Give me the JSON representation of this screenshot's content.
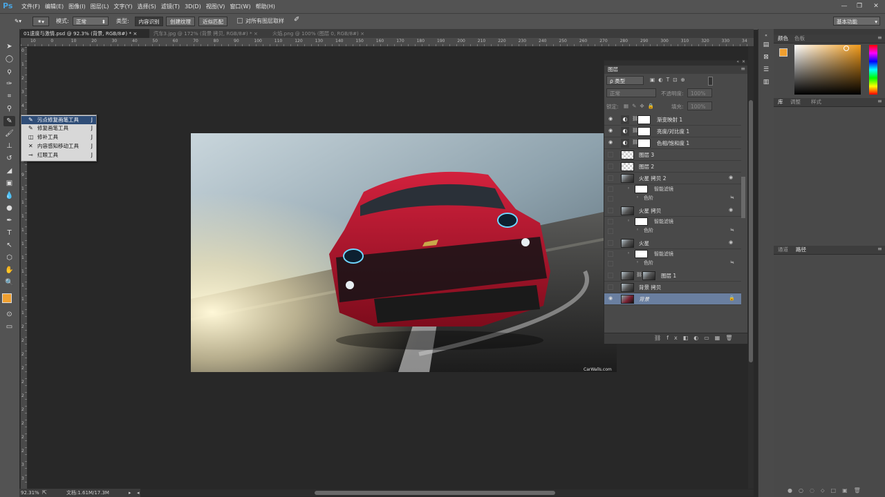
{
  "app": {
    "logo": "Ps",
    "brand_color": "#4aa3df"
  },
  "menu": [
    "文件(F)",
    "编辑(E)",
    "图像(I)",
    "图层(L)",
    "文字(Y)",
    "选择(S)",
    "滤镜(T)",
    "3D(D)",
    "视图(V)",
    "窗口(W)",
    "帮助(H)"
  ],
  "window_controls": {
    "minimize": "—",
    "restore": "❐",
    "close": "✕"
  },
  "options": {
    "mode_label": "模式:",
    "mode_value": "正常",
    "type_label": "类型:",
    "type_buttons": [
      "内容识别",
      "创建纹理",
      "近似匹配"
    ],
    "sample_all_layers": "对所有图层取样",
    "workspace": "基本功能"
  },
  "tabs": [
    {
      "label": "01速度与激情.psd @ 92.3% (背景, RGB/8#) *",
      "close": "×"
    },
    {
      "label": "汽车3.jpg @ 172% (背景 拷贝, RGB/8#) *",
      "close": "×"
    },
    {
      "label": "火焰.png @ 100% (图层 0, RGB/8#)",
      "close": "×"
    }
  ],
  "ruler_top": [
    "10",
    "0",
    "10",
    "20",
    "30",
    "40",
    "50",
    "60",
    "70",
    "80",
    "90",
    "100",
    "110",
    "120",
    "130",
    "140",
    "150",
    "160",
    "170",
    "180",
    "190",
    "200",
    "210",
    "220",
    "230",
    "240",
    "250",
    "260",
    "270",
    "280",
    "290",
    "300",
    "310",
    "320",
    "330",
    "34"
  ],
  "ruler_left": [
    "0",
    "1",
    "2",
    "3",
    "4",
    "5",
    "6",
    "7",
    "8",
    "9",
    "1",
    "1",
    "1",
    "1",
    "1",
    "1",
    "1",
    "1",
    "1",
    "1",
    "2",
    "2",
    "2",
    "2",
    "2",
    "2",
    "2",
    "2",
    "2",
    "2",
    "3",
    "3"
  ],
  "flyout": [
    {
      "label": "污点修复画笔工具",
      "shortcut": "J",
      "icon": "spot-healing-brush-icon",
      "selected": true
    },
    {
      "label": "修复画笔工具",
      "shortcut": "J",
      "icon": "healing-brush-icon",
      "selected": false
    },
    {
      "label": "修补工具",
      "shortcut": "J",
      "icon": "patch-icon",
      "selected": false
    },
    {
      "label": "内容感知移动工具",
      "shortcut": "J",
      "icon": "content-aware-move-icon",
      "selected": false
    },
    {
      "label": "红眼工具",
      "shortcut": "J",
      "icon": "red-eye-icon",
      "selected": false
    }
  ],
  "canvas": {
    "watermark": "CarWalls.com",
    "car_color": "#b0142c"
  },
  "status": {
    "zoom": "92.31%",
    "doc": "文档:1.61M/17.3M"
  },
  "right_panel": {
    "color_tabs": [
      "颜色",
      "色板"
    ],
    "foreground_color": "#f0a030",
    "lib_tabs": [
      "库",
      "调整",
      "样式"
    ],
    "path_tabs": [
      "通道",
      "路径"
    ]
  },
  "layers": {
    "title": "图层",
    "filter_label": "ρ 类型",
    "blend_mode": "正常",
    "opacity_label": "不透明度:",
    "opacity_value": "100%",
    "lock_label": "锁定:",
    "fill_label": "填充:",
    "fill_value": "100%",
    "rows": [
      {
        "name": "渐变映射 1",
        "kind": "adjustment",
        "visible": true
      },
      {
        "name": "亮度/对比度 1",
        "kind": "adjustment",
        "visible": true
      },
      {
        "name": "色相/饱和度 1",
        "kind": "adjustment",
        "visible": true
      },
      {
        "name": "图层 3",
        "kind": "pixel",
        "visible": false
      },
      {
        "name": "图层 2",
        "kind": "pixel",
        "visible": false
      },
      {
        "name": "火星 拷贝 2",
        "kind": "smart",
        "visible": false
      },
      {
        "name": "智能滤镜",
        "kind": "filter",
        "visible": false
      },
      {
        "name": "色阶",
        "kind": "filter-item",
        "visible": false
      },
      {
        "name": "火星 拷贝",
        "kind": "smart",
        "visible": false
      },
      {
        "name": "智能滤镜",
        "kind": "filter",
        "visible": false
      },
      {
        "name": "色阶",
        "kind": "filter-item",
        "visible": false
      },
      {
        "name": "火星",
        "kind": "smart",
        "visible": false
      },
      {
        "name": "智能滤镜",
        "kind": "filter",
        "visible": false
      },
      {
        "name": "色阶",
        "kind": "filter-item",
        "visible": false
      },
      {
        "name": "图层 1",
        "kind": "masked",
        "visible": false
      },
      {
        "name": "背景 拷贝",
        "kind": "photo",
        "visible": false
      },
      {
        "name": "背景",
        "kind": "background",
        "visible": true,
        "selected": true
      }
    ]
  }
}
